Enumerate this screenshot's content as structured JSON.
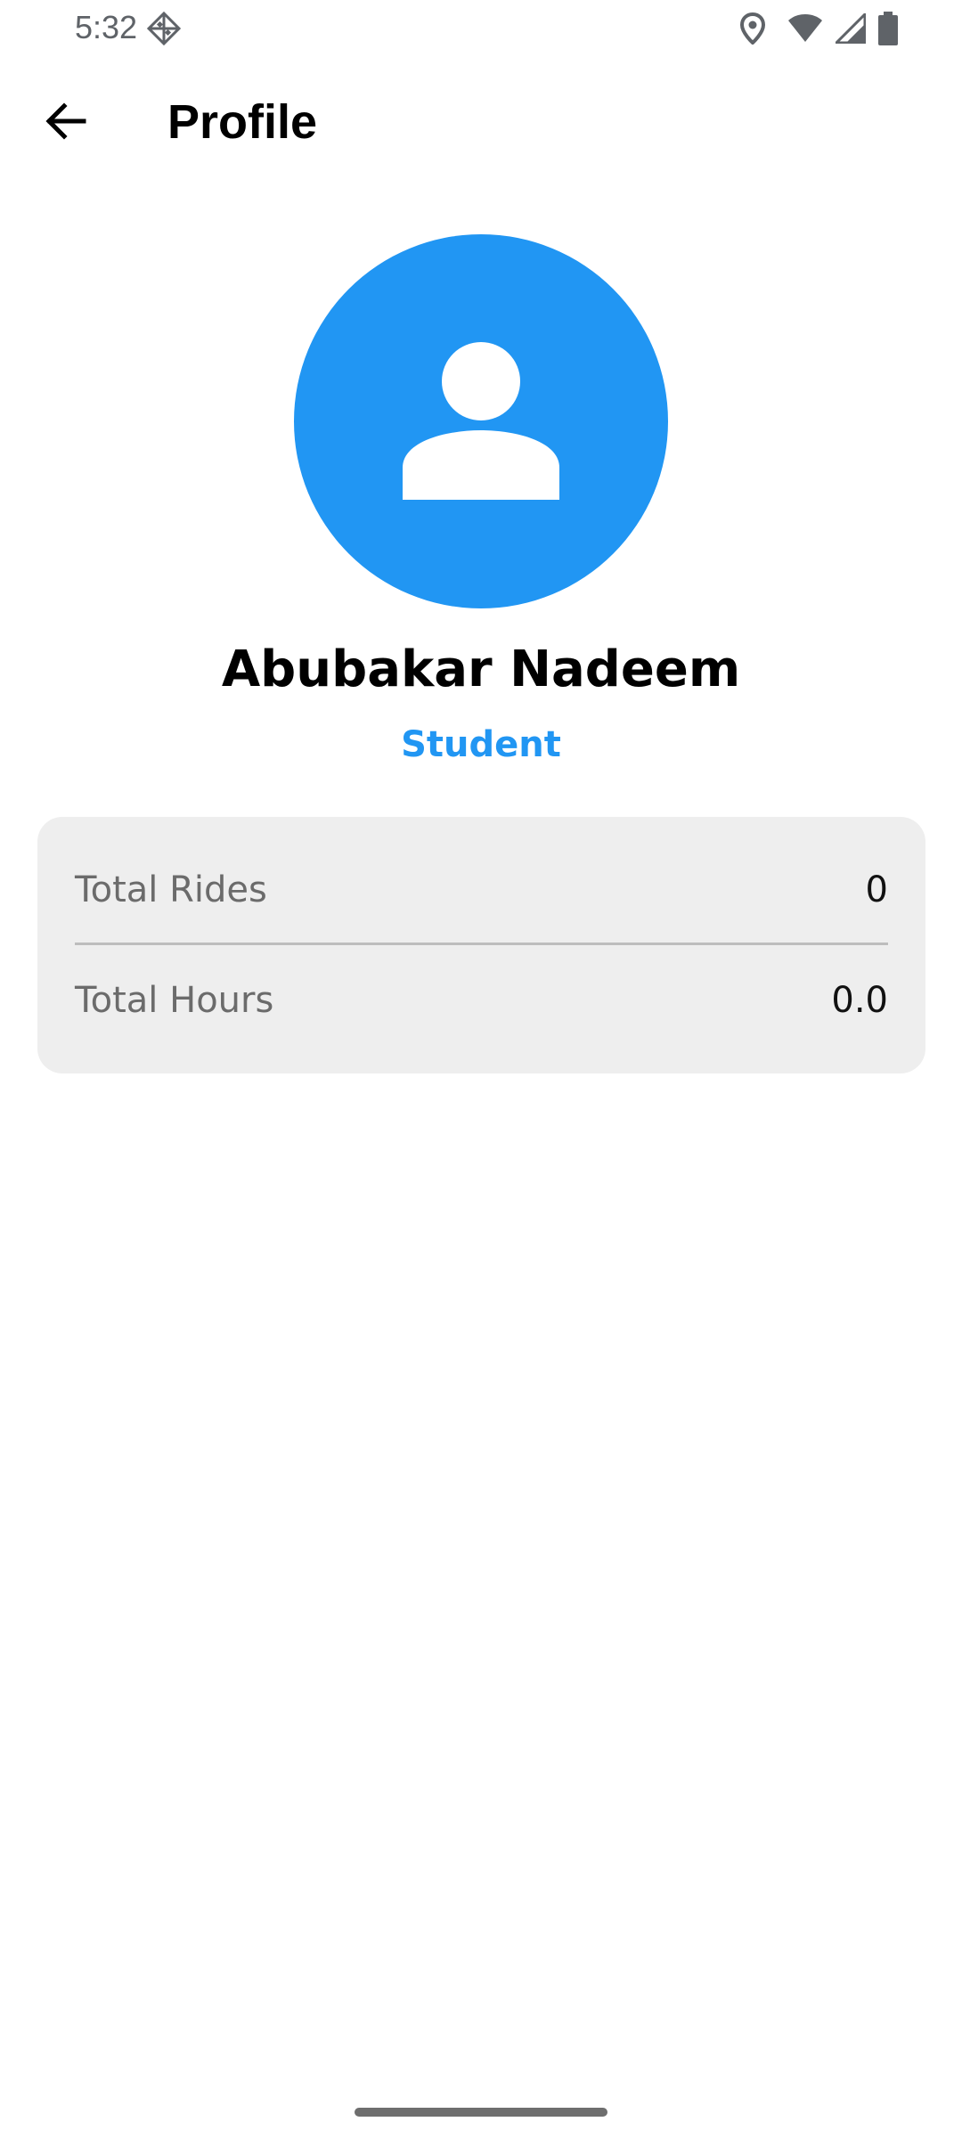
{
  "status_bar": {
    "time": "5:32",
    "left_icon": "diamond-grid-icon",
    "right_icons": [
      "location-icon",
      "wifi-icon",
      "signal-icon",
      "battery-icon"
    ]
  },
  "header": {
    "back_icon": "arrow-back-icon",
    "title": "Profile"
  },
  "profile": {
    "avatar_icon": "person-icon",
    "name": "Abubakar Nadeem",
    "role": "Student"
  },
  "stats": [
    {
      "label": "Total Rides",
      "value": "0"
    },
    {
      "label": "Total Hours",
      "value": "0.0"
    }
  ],
  "colors": {
    "accent": "#2196f3",
    "card_background": "#eeeeee",
    "label_text": "#6b6b6b"
  }
}
